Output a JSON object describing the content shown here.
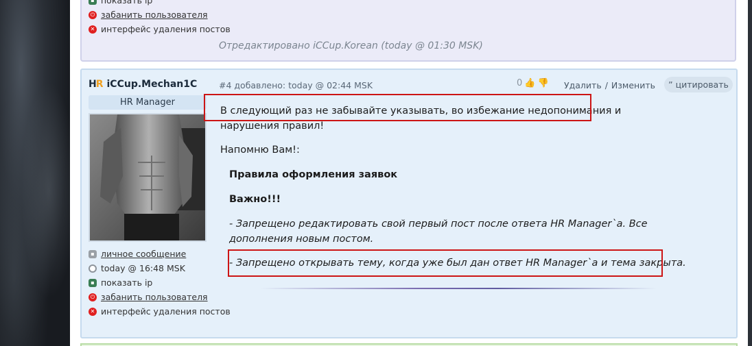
{
  "previous_post": {
    "links": [
      {
        "label": "показать ip",
        "underline": false
      },
      {
        "label": "забанить пользователя",
        "underline": true
      },
      {
        "label": "интерфейс удаления постов",
        "underline": false
      }
    ],
    "edited_note": "Отредактировано iCCup.Korean (today @ 01:30 MSK)"
  },
  "post": {
    "author_logo_h": "H",
    "author_logo_r": "R",
    "author_name": "iCCup.Mechan1C",
    "role": "HR Manager",
    "meta": "#4 добавлено: today @ 02:44 MSK",
    "like_count": "0",
    "actions": {
      "delete": "Удалить",
      "separator": "/",
      "edit": "Изменить"
    },
    "quote_button": "” цитировать",
    "paragraph1": "В следующий раз не забывайте указывать, во избежание недопонимания и нарушения правил!",
    "paragraph2": "Напомню Вам!:",
    "quote": {
      "title": "Правила оформления заявок",
      "important": "Важно!!!",
      "rule1": "- Запрещено редактировать свой первый пост после ответа HR Manager`а. Все дополнения новым постом.",
      "rule2": "- Запрещено открывать тему, когда уже был дан ответ HR Manager`а и тема закрыта."
    },
    "links": [
      {
        "label": "личное сообщение"
      },
      {
        "label": "today @ 16:48 MSK"
      },
      {
        "label": "показать ip"
      },
      {
        "label": "забанить пользователя"
      },
      {
        "label": "интерфейс удаления постов"
      }
    ]
  },
  "colors": {
    "highlight_box": "#cc1414",
    "post_bg": "#e5f0fa",
    "prev_post_bg": "#ebebf8"
  }
}
